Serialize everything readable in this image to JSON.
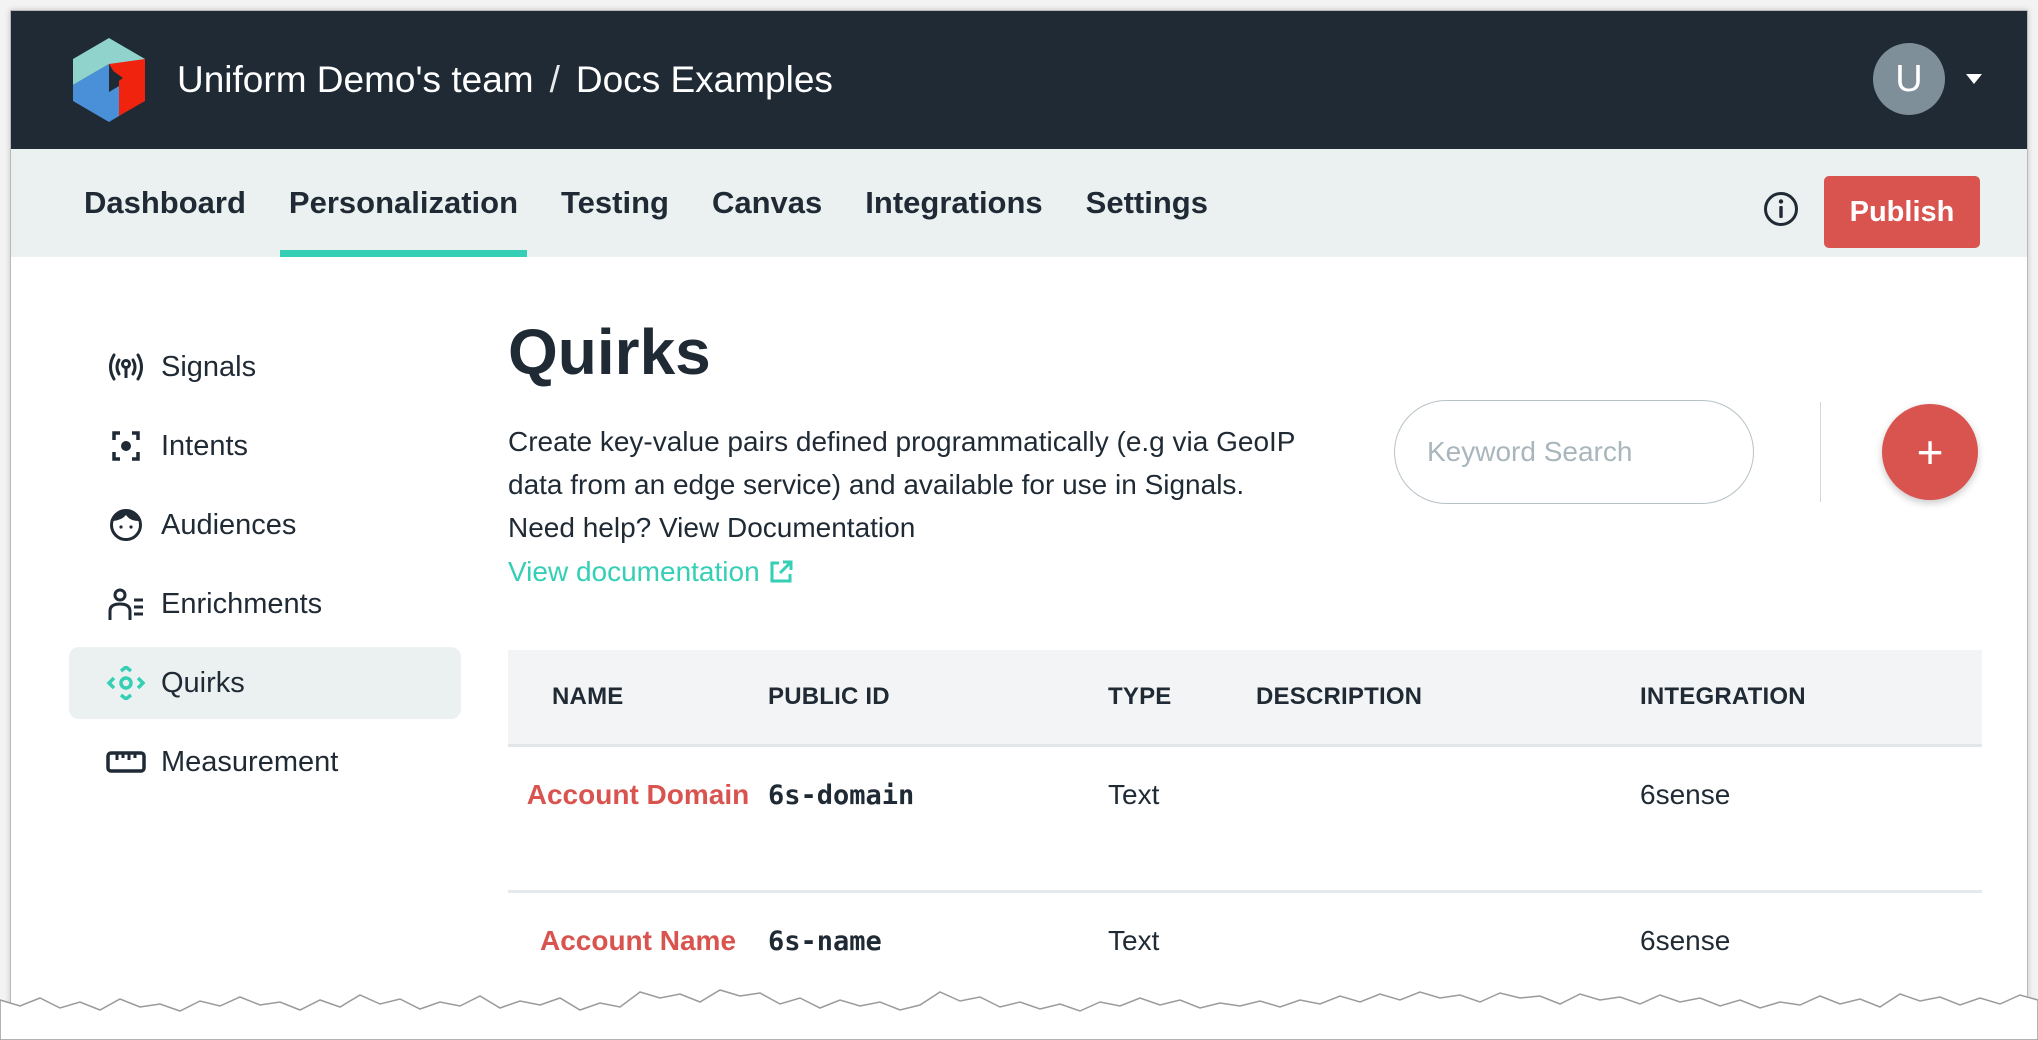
{
  "header": {
    "team": "Uniform Demo's team",
    "separator": "/",
    "project": "Docs Examples",
    "avatar_initial": "U"
  },
  "nav": {
    "tabs": [
      {
        "label": "Dashboard",
        "active": false
      },
      {
        "label": "Personalization",
        "active": true
      },
      {
        "label": "Testing",
        "active": false
      },
      {
        "label": "Canvas",
        "active": false
      },
      {
        "label": "Integrations",
        "active": false
      },
      {
        "label": "Settings",
        "active": false
      }
    ],
    "publish_label": "Publish"
  },
  "sidebar": {
    "items": [
      {
        "label": "Signals",
        "icon": "signal-broadcast-icon",
        "active": false
      },
      {
        "label": "Intents",
        "icon": "focus-target-icon",
        "active": false
      },
      {
        "label": "Audiences",
        "icon": "face-icon",
        "active": false
      },
      {
        "label": "Enrichments",
        "icon": "user-list-icon",
        "active": false
      },
      {
        "label": "Quirks",
        "icon": "quirks-arrows-icon",
        "active": true
      },
      {
        "label": "Measurement",
        "icon": "ruler-icon",
        "active": false
      }
    ]
  },
  "main": {
    "title": "Quirks",
    "description": "Create key-value pairs defined programmatically (e.g via GeoIP data from an edge service) and available for use in Signals. Need help? View Documentation",
    "doc_link": "View documentation",
    "search_placeholder": "Keyword Search",
    "add_label": "+"
  },
  "table": {
    "columns": [
      "NAME",
      "PUBLIC ID",
      "TYPE",
      "DESCRIPTION",
      "INTEGRATION"
    ],
    "rows": [
      {
        "name": "Account Domain",
        "public_id": "6s-domain",
        "type": "Text",
        "description": "",
        "integration": "6sense"
      },
      {
        "name": "Account Name",
        "public_id": "6s-name",
        "type": "Text",
        "description": "",
        "integration": "6sense"
      }
    ]
  },
  "colors": {
    "header_bg": "#1f2a35",
    "nav_bg": "#ebf1f1",
    "accent_teal": "#35cfb5",
    "accent_red": "#d9534f",
    "text_primary": "#1f2a35"
  }
}
